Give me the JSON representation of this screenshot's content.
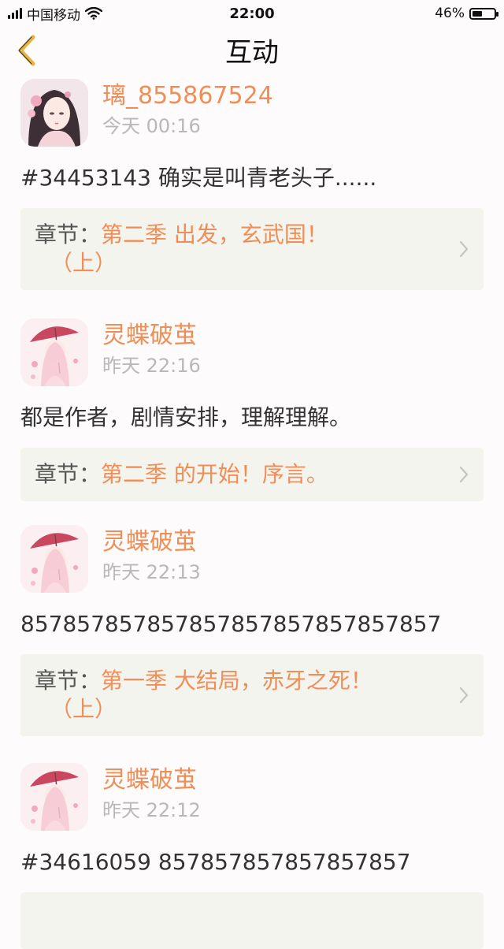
{
  "status_bar": {
    "carrier": "中国移动",
    "time": "22:00",
    "battery_percent": "46%",
    "battery_level": 0.46,
    "icons": [
      "signal-icon",
      "wifi-icon",
      "battery-icon"
    ]
  },
  "header": {
    "title": "互动",
    "back_icon": "chevron-left-icon"
  },
  "colors": {
    "accent": "#ef8e57",
    "muted": "#b8b8b8",
    "card_bg": "#f4f4ef",
    "back_icon": "#e9b23a"
  },
  "chapter_prefix": "章节：",
  "posts": [
    {
      "username": "璃_855867524",
      "time": "今天 00:16",
      "content": "#34453143 确实是叫青老头子......",
      "chapter_line1": "第二季  出发，玄武国！",
      "chapter_line2": "（上）",
      "avatar": "portrait-avatar"
    },
    {
      "username": "灵蝶破茧",
      "time": "昨天 22:16",
      "content": "都是作者，剧情安排，理解理解。",
      "chapter_line1": "第二季  的开始！序言。",
      "chapter_line2": "",
      "avatar": "umbrella-girl-avatar"
    },
    {
      "username": "灵蝶破茧",
      "time": "昨天 22:13",
      "content": "857857857857857857857857857857",
      "chapter_line1": "第一季  大结局，赤牙之死！",
      "chapter_line2": "（上）",
      "avatar": "umbrella-girl-avatar"
    },
    {
      "username": "灵蝶破茧",
      "time": "昨天 22:12",
      "content": "#34616059 857857857857857857",
      "chapter_line1": "",
      "chapter_line2": "",
      "avatar": "umbrella-girl-avatar"
    }
  ]
}
